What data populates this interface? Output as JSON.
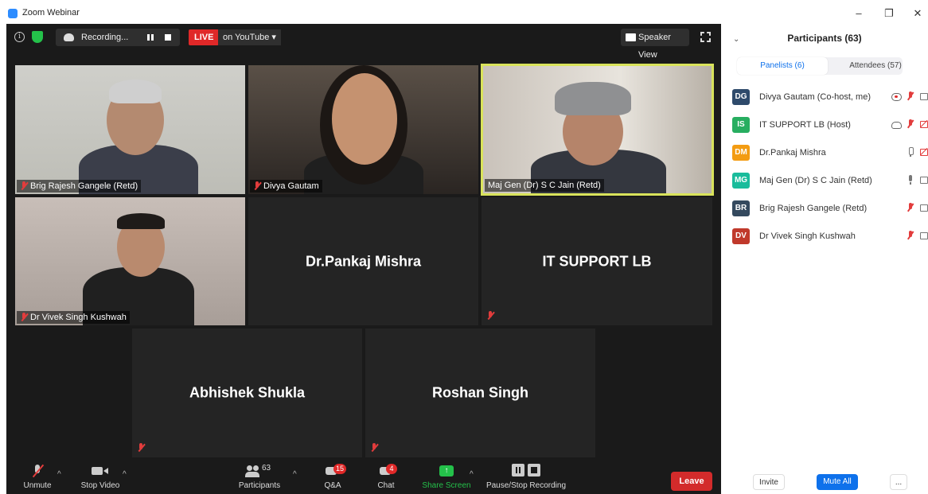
{
  "window": {
    "title": "Zoom Webinar",
    "minimize": "–",
    "maximize": "❐",
    "close": "✕"
  },
  "topbar": {
    "recording_label": "Recording...",
    "live_label": "LIVE",
    "stream_label": "on YouTube ▾",
    "view_label": "Speaker View"
  },
  "tiles": {
    "t1_name": "Brig Rajesh Gangele (Retd)",
    "t2_name": "Divya Gautam",
    "t3_name": "Maj Gen (Dr) S C Jain (Retd)",
    "t4_name": "Dr Vivek Singh Kushwah",
    "t5_name": "Dr.Pankaj Mishra",
    "t6_name": "IT SUPPORT LB",
    "t7_name": "Abhishek Shukla",
    "t8_name": "Roshan Singh"
  },
  "toolbar": {
    "unmute": "Unmute",
    "stop_video": "Stop Video",
    "participants": "Participants",
    "participants_count": "63",
    "qa": "Q&A",
    "qa_badge": "15",
    "chat": "Chat",
    "chat_badge": "4",
    "share_screen": "Share Screen",
    "pause_recording": "Pause/Stop Recording",
    "leave": "Leave"
  },
  "panel": {
    "title": "Participants (63)",
    "tab_panelists": "Panelists (6)",
    "tab_attendees": "Attendees (57)",
    "participants": [
      {
        "initials": "DG",
        "name": "Divya Gautam (Co-host, me)",
        "color": "#2e4a6b"
      },
      {
        "initials": "IS",
        "name": "IT SUPPORT LB (Host)",
        "color": "#27ae60"
      },
      {
        "initials": "DM",
        "name": "Dr.Pankaj Mishra",
        "color": "#f39c12"
      },
      {
        "initials": "MG",
        "name": "Maj Gen (Dr) S C Jain (Retd)",
        "color": "#1abc9c"
      },
      {
        "initials": "BR",
        "name": "Brig Rajesh Gangele (Retd)",
        "color": "#34495e"
      },
      {
        "initials": "DV",
        "name": "Dr Vivek Singh Kushwah",
        "color": "#c0392b"
      }
    ],
    "invite": "Invite",
    "mute_all": "Mute All",
    "more": "..."
  },
  "colors": {
    "accent": "#0e71eb",
    "leave": "#d32b2b",
    "live": "#e02828",
    "active_speaker": "#d9e35b"
  }
}
